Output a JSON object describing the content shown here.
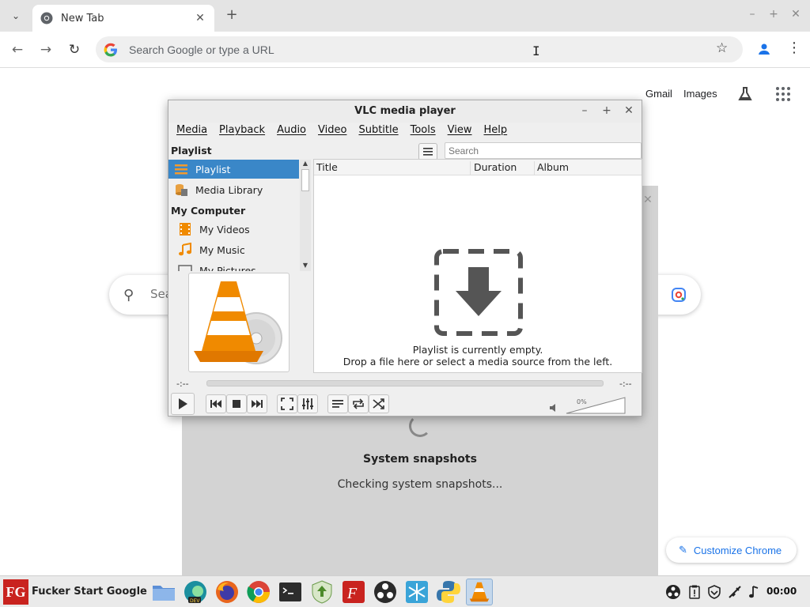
{
  "browser": {
    "tab": {
      "title": "New Tab"
    },
    "omnibox": {
      "placeholder": "Search Google or type a URL"
    }
  },
  "newtab": {
    "links": {
      "gmail": "Gmail",
      "images": "Images"
    },
    "search_box_text": "Sea",
    "snapshot_panel": {
      "title": "System snapshots",
      "subtitle": "Checking system snapshots..."
    },
    "customize_label": "Customize Chrome"
  },
  "vlc": {
    "title": "VLC media player",
    "menus": [
      "Media",
      "Playback",
      "Audio",
      "Video",
      "Subtitle",
      "Tools",
      "View",
      "Help"
    ],
    "sidebar": {
      "heading": "Playlist",
      "items": [
        {
          "label": "Playlist",
          "icon": "playlist-icon"
        },
        {
          "label": "Media Library",
          "icon": "media-library-icon"
        },
        {
          "label": "My Computer",
          "icon": ""
        },
        {
          "label": "My Videos",
          "icon": "videos-icon"
        },
        {
          "label": "My Music",
          "icon": "music-icon"
        },
        {
          "label": "My Pictures",
          "icon": "pictures-icon"
        }
      ]
    },
    "search_placeholder": "Search",
    "columns": [
      "Title",
      "Duration",
      "Album"
    ],
    "empty_line1": "Playlist is currently empty.",
    "empty_line2": "Drop a file here or select a media source from the left.",
    "elapsed": "-:--",
    "remaining": "-:--",
    "volume_percent": "0%"
  },
  "taskbar": {
    "start_label": "Fucker Start Google",
    "start_logo_text": "FG",
    "clock": "00:00"
  },
  "colors": {
    "selection": "#3a87c8",
    "google_blue": "#1a73e8",
    "vlc_orange": "#f08a00"
  }
}
